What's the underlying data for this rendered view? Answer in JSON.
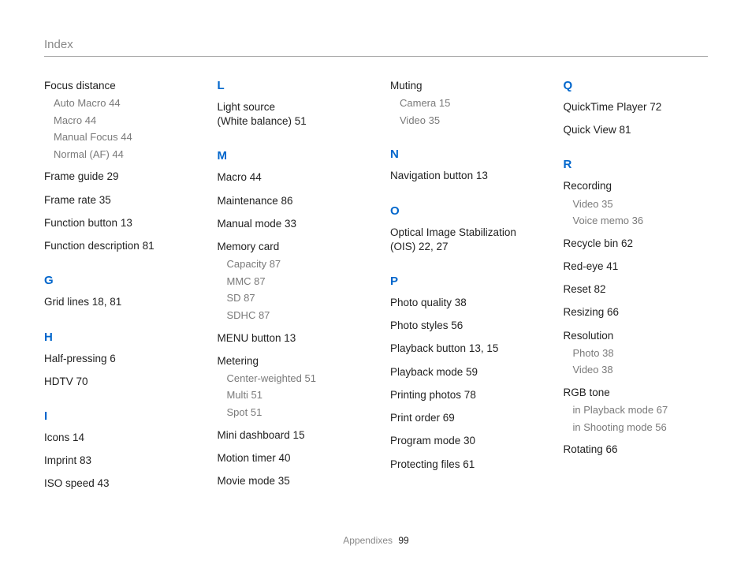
{
  "header": {
    "title": "Index"
  },
  "footer": {
    "section": "Appendixes",
    "page": "99"
  },
  "col1": {
    "focus_distance": {
      "title": "Focus distance",
      "subs": [
        "Auto Macro  44",
        "Macro  44",
        "Manual Focus  44",
        "Normal (AF)  44"
      ]
    },
    "frame_guide": "Frame guide  29",
    "frame_rate": "Frame rate  35",
    "function_button": "Function button  13",
    "function_description": "Function description  81",
    "G": "G",
    "grid_lines": "Grid lines  18, 81",
    "H": "H",
    "half_pressing": "Half-pressing  6",
    "hdtv": "HDTV  70",
    "I": "I",
    "icons": "Icons  14",
    "imprint": "Imprint  83",
    "iso_speed": "ISO speed  43"
  },
  "col2": {
    "L": "L",
    "light_source": "Light source\n(White balance)  51",
    "M": "M",
    "macro": "Macro  44",
    "maintenance": "Maintenance  86",
    "manual_mode": "Manual mode  33",
    "memory_card": {
      "title": "Memory card",
      "subs": [
        "Capacity  87",
        "MMC  87",
        "SD  87",
        "SDHC  87"
      ]
    },
    "menu_button": "MENU button  13",
    "metering": {
      "title": "Metering",
      "subs": [
        "Center-weighted  51",
        "Multi  51",
        "Spot  51"
      ]
    },
    "mini_dashboard": "Mini dashboard  15",
    "motion_timer": "Motion timer  40",
    "movie_mode": "Movie mode  35"
  },
  "col3": {
    "muting": {
      "title": "Muting",
      "subs": [
        "Camera  15",
        "Video  35"
      ]
    },
    "N": "N",
    "navigation_button": "Navigation button  13",
    "O": "O",
    "ois": "Optical Image Stabilization (OIS)  22, 27",
    "P": "P",
    "photo_quality": "Photo quality  38",
    "photo_styles": "Photo styles  56",
    "playback_button": "Playback button  13, 15",
    "playback_mode": "Playback mode  59",
    "printing_photos": "Printing photos  78",
    "print_order": "Print order  69",
    "program_mode": "Program mode  30",
    "protecting_files": "Protecting files  61"
  },
  "col4": {
    "Q": "Q",
    "quicktime": "QuickTime Player  72",
    "quick_view": "Quick View  81",
    "R": "R",
    "recording": {
      "title": "Recording",
      "subs": [
        "Video  35",
        "Voice memo  36"
      ]
    },
    "recycle_bin": "Recycle bin  62",
    "red_eye": "Red-eye  41",
    "reset": "Reset  82",
    "resizing": "Resizing  66",
    "resolution": {
      "title": "Resolution",
      "subs": [
        "Photo  38",
        "Video  38"
      ]
    },
    "rgb_tone": {
      "title": "RGB tone",
      "subs": [
        "in Playback mode  67",
        "in Shooting mode  56"
      ]
    },
    "rotating": "Rotating  66"
  }
}
